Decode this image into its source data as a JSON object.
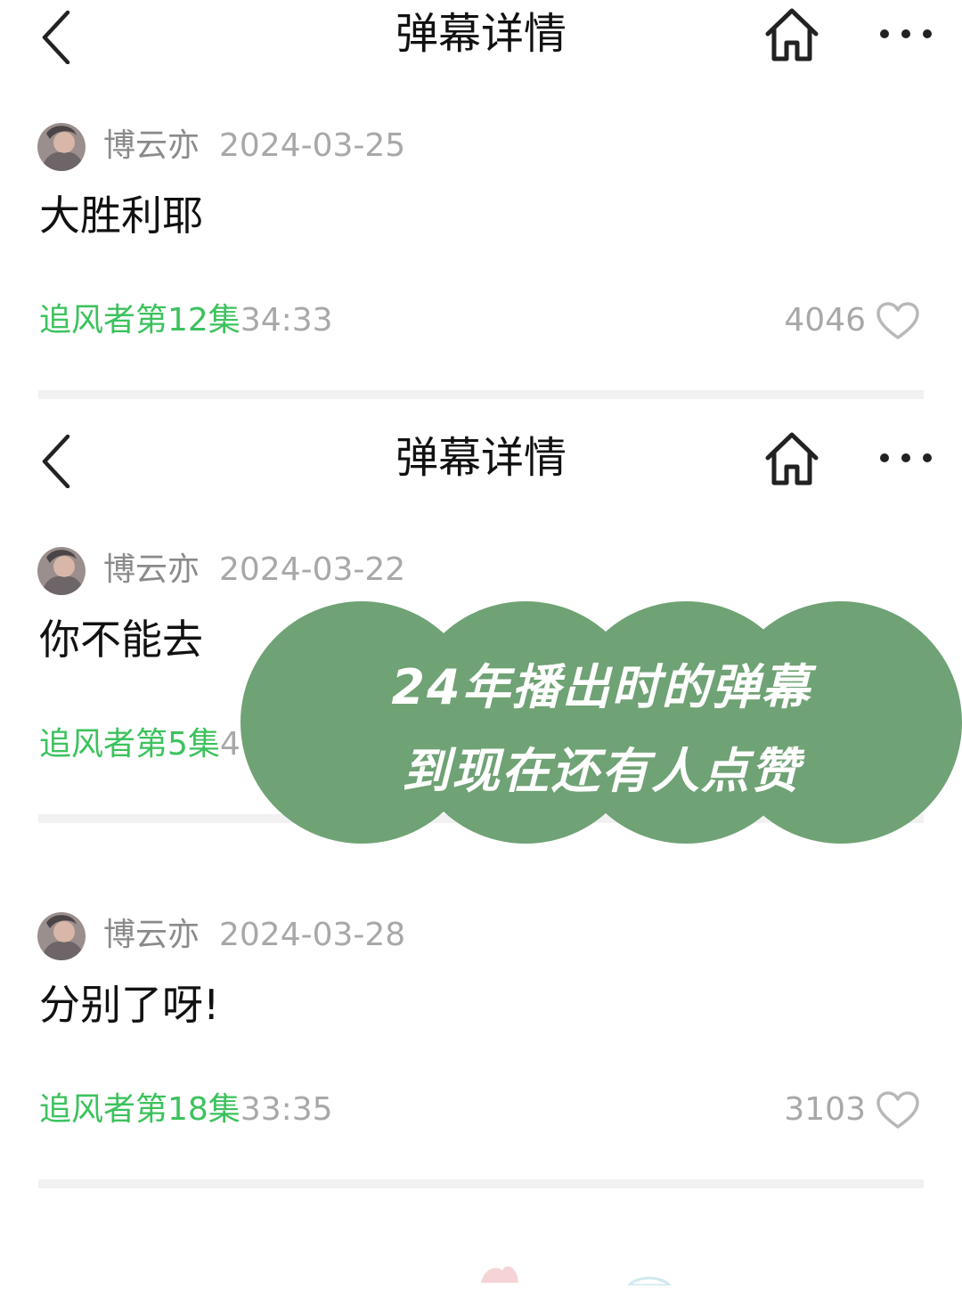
{
  "screens": [
    {
      "header": {
        "title": "弹幕详情"
      },
      "comment": {
        "username": "博云亦",
        "date": "2024-03-25",
        "text": "大胜利耶",
        "episode": "追风者第12集",
        "timestamp": "34:33",
        "likes": "4046"
      }
    },
    {
      "header": {
        "title": "弹幕详情"
      },
      "comment": {
        "username": "博云亦",
        "date": "2024-03-22",
        "text": "你不能去",
        "episode": "追风者第5集",
        "timestamp": "4"
      }
    },
    {
      "comment": {
        "username": "博云亦",
        "date": "2024-03-28",
        "text": "分别了呀!",
        "episode": "追风者第18集",
        "timestamp": "33:35",
        "likes": "3103"
      }
    }
  ],
  "banner": {
    "line1": "24年播出时的弹幕",
    "line2": "到现在还有人点赞",
    "color": "#6fa274"
  },
  "colors": {
    "episode_green": "#3cc25d",
    "meta_gray": "#a8a8a8",
    "divider": "#f1f1f1"
  },
  "icons": [
    "chevron-left-icon",
    "home-icon",
    "more-dots-icon",
    "heart-icon"
  ]
}
